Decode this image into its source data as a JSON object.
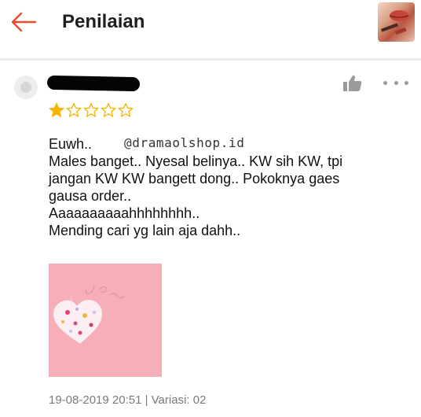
{
  "header": {
    "title": "Penilaian",
    "back_icon": "arrow-left-icon"
  },
  "review": {
    "rating": 1,
    "rating_max": 5,
    "star_color_filled": "#f5b400",
    "star_color_empty": "#f5b400",
    "watermark": "@dramaolshop.id",
    "lines": [
      "Euwh..",
      "Males banget.. Nyesal belinya.. KW sih KW, tpi",
      "jangan KW KW bangett dong.. Pokoknya gaes",
      "gausa order..",
      "Aaaaaaaaaahhhhhhhh..",
      "Mending cari yg lain aja dahh.."
    ],
    "meta": "19-08-2019 20:51 | Variasi: 02"
  },
  "colors": {
    "accent": "#ee4d2d",
    "photo_bg": "#f7b3bd"
  }
}
